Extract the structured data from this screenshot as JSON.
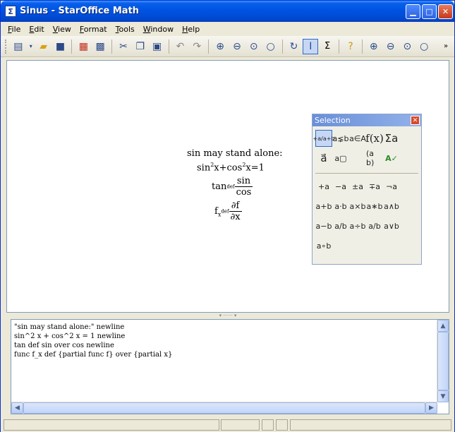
{
  "window": {
    "title": "Sinus - StarOffice Math",
    "app_icon": "document-icon"
  },
  "menu": [
    "File",
    "Edit",
    "View",
    "Format",
    "Tools",
    "Window",
    "Help"
  ],
  "toolbar": {
    "icons": [
      "new-icon",
      "open-icon",
      "save-icon",
      "export-pdf-icon",
      "print-icon",
      "cut-icon",
      "copy-icon",
      "paste-icon",
      "undo-icon",
      "redo-icon",
      "zoom-in-icon",
      "zoom-out-icon",
      "zoom-100-icon",
      "zoom-page-icon",
      "refresh-icon",
      "formula-cursor-icon",
      "symbols-icon",
      "help-icon",
      "zoom-in-icon",
      "zoom-out-icon",
      "zoom-100-icon",
      "zoom-page-icon"
    ]
  },
  "formula": {
    "line1": "sin may stand alone:",
    "line2_a": "sin",
    "line2_b": "2",
    "line2_c": "x+cos",
    "line2_d": "2",
    "line2_e": "x=1",
    "line3_a": "tan",
    "line3_def": "def",
    "line3_num": "sin",
    "line3_den": "cos",
    "line4_a": "f",
    "line4_sub": "x",
    "line4_def": "def",
    "line4_num": "∂f",
    "line4_den": "∂x"
  },
  "selection": {
    "title": "Selection",
    "row1": [
      "+a/a+b",
      "a⋦b",
      "a∈A",
      "f(x)",
      "Σa"
    ],
    "row2": [
      "a⃗",
      "a▢",
      "",
      "(a b)",
      "A✓"
    ],
    "row3": [
      "+a",
      "−a",
      "±a",
      "∓a",
      "¬a"
    ],
    "row4": [
      "a+b",
      "a·b",
      "a×b",
      "a∗b",
      "a∧b"
    ],
    "row5": [
      "a−b",
      "a/b",
      "a÷b",
      "a/b",
      "a∨b"
    ],
    "row6": [
      "a∘b"
    ]
  },
  "command": {
    "text": "\"sin may stand alone:\" newline\nsin^2 x + cos^2 x = 1 newline\ntan def sin over cos newline\nfunc f_x def {partial func f} over {partial x}"
  }
}
